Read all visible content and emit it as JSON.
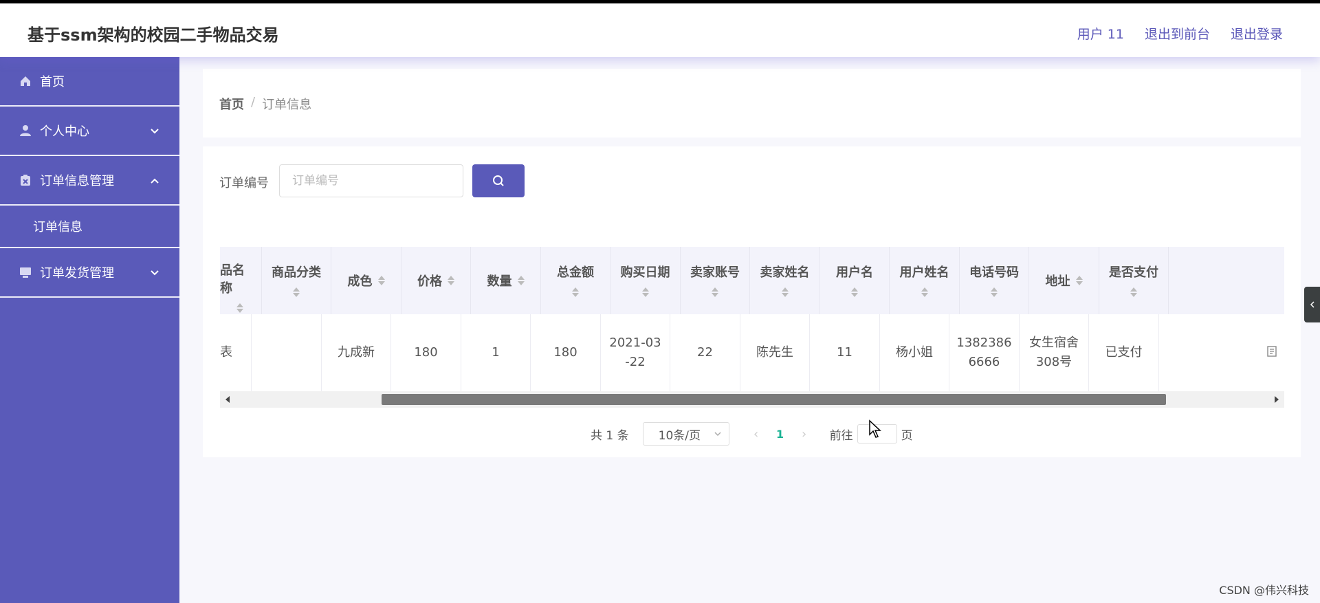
{
  "header": {
    "title": "基于ssm架构的校园二手物品交易",
    "user": "用户 11",
    "to_front": "退出到前台",
    "logout": "退出登录"
  },
  "sidebar": {
    "items": [
      {
        "label": "首页",
        "icon": "home-icon"
      },
      {
        "label": "个人中心",
        "icon": "user-icon",
        "chevron": "down"
      },
      {
        "label": "订单信息管理",
        "icon": "clipboard-icon",
        "chevron": "up",
        "children": [
          "订单信息"
        ]
      },
      {
        "label": "订单发货管理",
        "icon": "monitor-icon",
        "chevron": "down"
      }
    ]
  },
  "breadcrumb": {
    "home": "首页",
    "separator": "/",
    "current": "订单信息"
  },
  "search": {
    "label": "订单编号",
    "placeholder": "订单编号",
    "value": ""
  },
  "table": {
    "headers": [
      "品名称",
      "商品分类",
      "成色",
      "价格",
      "数量",
      "总金额",
      "购买日期",
      "卖家账号",
      "卖家姓名",
      "用户名",
      "用户姓名",
      "电话号码",
      "地址",
      "是否支付"
    ],
    "rows": [
      {
        "cells": [
          "表",
          "",
          "九成新",
          "180",
          "1",
          "180",
          "2021-03\n-22",
          "22",
          "陈先生",
          "11",
          "杨小姐",
          "1382386\n6666",
          "女生宿舍\n308号",
          "已支付"
        ]
      }
    ]
  },
  "pagination": {
    "total": "共 1 条",
    "page_size": "10条/页",
    "current_page": "1",
    "goto_label": "前往",
    "page_suffix": "页"
  },
  "watermark": "CSDN @伟兴科技",
  "colors": {
    "accent": "#5a5ab9",
    "pager_active": "#1ab394"
  }
}
